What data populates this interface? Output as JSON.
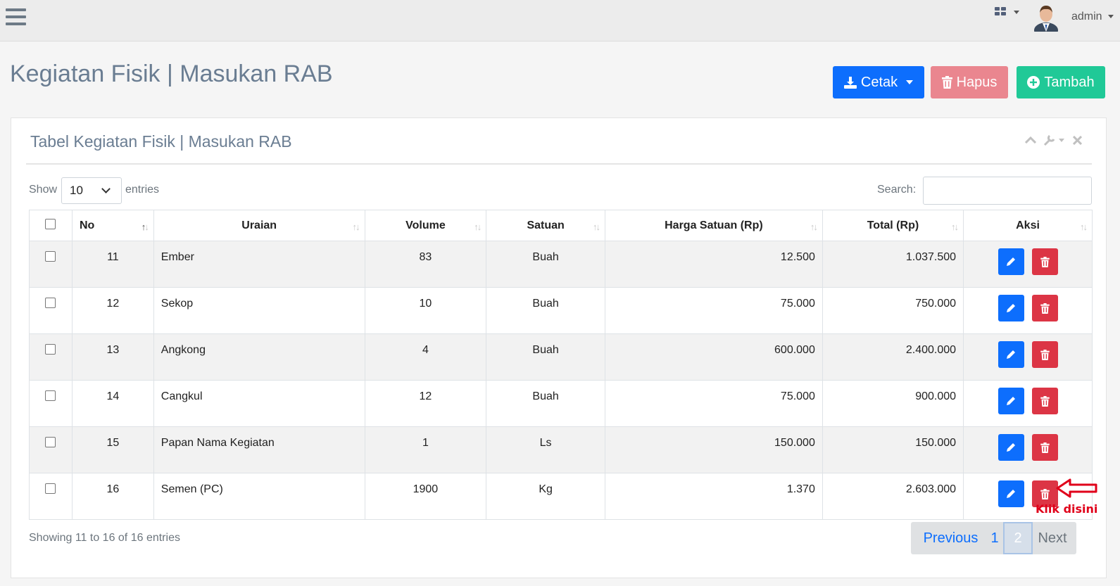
{
  "topbar": {
    "user": "admin"
  },
  "page": {
    "title": "Kegiatan Fisik | Masukan RAB"
  },
  "actions": {
    "cetak": "Cetak",
    "hapus": "Hapus",
    "tambah": "Tambah"
  },
  "card": {
    "title": "Tabel Kegiatan Fisik | Masukan RAB"
  },
  "length": {
    "show": "Show",
    "value": "10",
    "entries": "entries"
  },
  "search": {
    "label": "Search:"
  },
  "table": {
    "headers": [
      "No",
      "Uraian",
      "Volume",
      "Satuan",
      "Harga Satuan (Rp)",
      "Total (Rp)",
      "Aksi"
    ],
    "rows": [
      {
        "no": "11",
        "uraian": "Ember",
        "volume": "83",
        "satuan": "Buah",
        "harga": "12.500",
        "total": "1.037.500"
      },
      {
        "no": "12",
        "uraian": "Sekop",
        "volume": "10",
        "satuan": "Buah",
        "harga": "75.000",
        "total": "750.000"
      },
      {
        "no": "13",
        "uraian": "Angkong",
        "volume": "4",
        "satuan": "Buah",
        "harga": "600.000",
        "total": "2.400.000"
      },
      {
        "no": "14",
        "uraian": "Cangkul",
        "volume": "12",
        "satuan": "Buah",
        "harga": "75.000",
        "total": "900.000"
      },
      {
        "no": "15",
        "uraian": "Papan Nama Kegiatan",
        "volume": "1",
        "satuan": "Ls",
        "harga": "150.000",
        "total": "150.000"
      },
      {
        "no": "16",
        "uraian": "Semen (PC)",
        "volume": "1900",
        "satuan": "Kg",
        "harga": "1.370",
        "total": "2.603.000"
      }
    ]
  },
  "footer": {
    "info": "Showing 11 to 16 of 16 entries"
  },
  "pagination": {
    "previous": "Previous",
    "page1": "1",
    "page2": "2",
    "next": "Next"
  },
  "annotation": {
    "label": "Klik disini",
    "color": "#e0001a"
  }
}
